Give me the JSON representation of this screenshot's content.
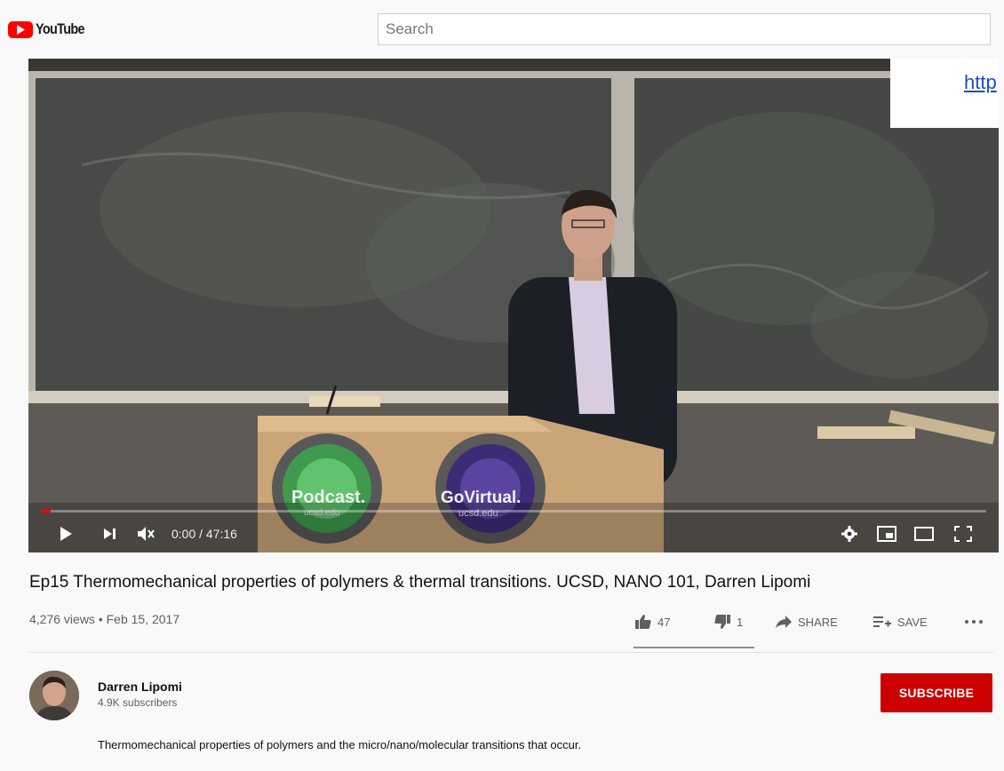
{
  "header": {
    "logo_text": "YouTube",
    "search_placeholder": "Search"
  },
  "player": {
    "overlay_link_text": "http",
    "podium_logo_left": "Podcast.",
    "podium_logo_left_sub": "ucsd.edu",
    "podium_logo_right": "GoVirtual.",
    "podium_logo_right_sub": "ucsd.edu",
    "time_display": "0:00 / 47:16",
    "progress_fraction": 0.01
  },
  "video": {
    "title": "Ep15 Thermomechanical properties of polymers & thermal transitions. UCSD, NANO 101, Darren Lipomi",
    "meta": "4,276 views • Feb 15, 2017",
    "likes": "47",
    "dislikes": "1",
    "share_label": "SHARE",
    "save_label": "SAVE"
  },
  "channel": {
    "name": "Darren Lipomi",
    "subscribers": "4.9K subscribers",
    "subscribe_label": "SUBSCRIBE"
  },
  "description": "Thermomechanical properties of polymers and the micro/nano/molecular transitions that occur.",
  "colors": {
    "brand_red": "#ff0000",
    "subscribe_red": "#cc0000",
    "link_blue": "#1a4dcc"
  }
}
